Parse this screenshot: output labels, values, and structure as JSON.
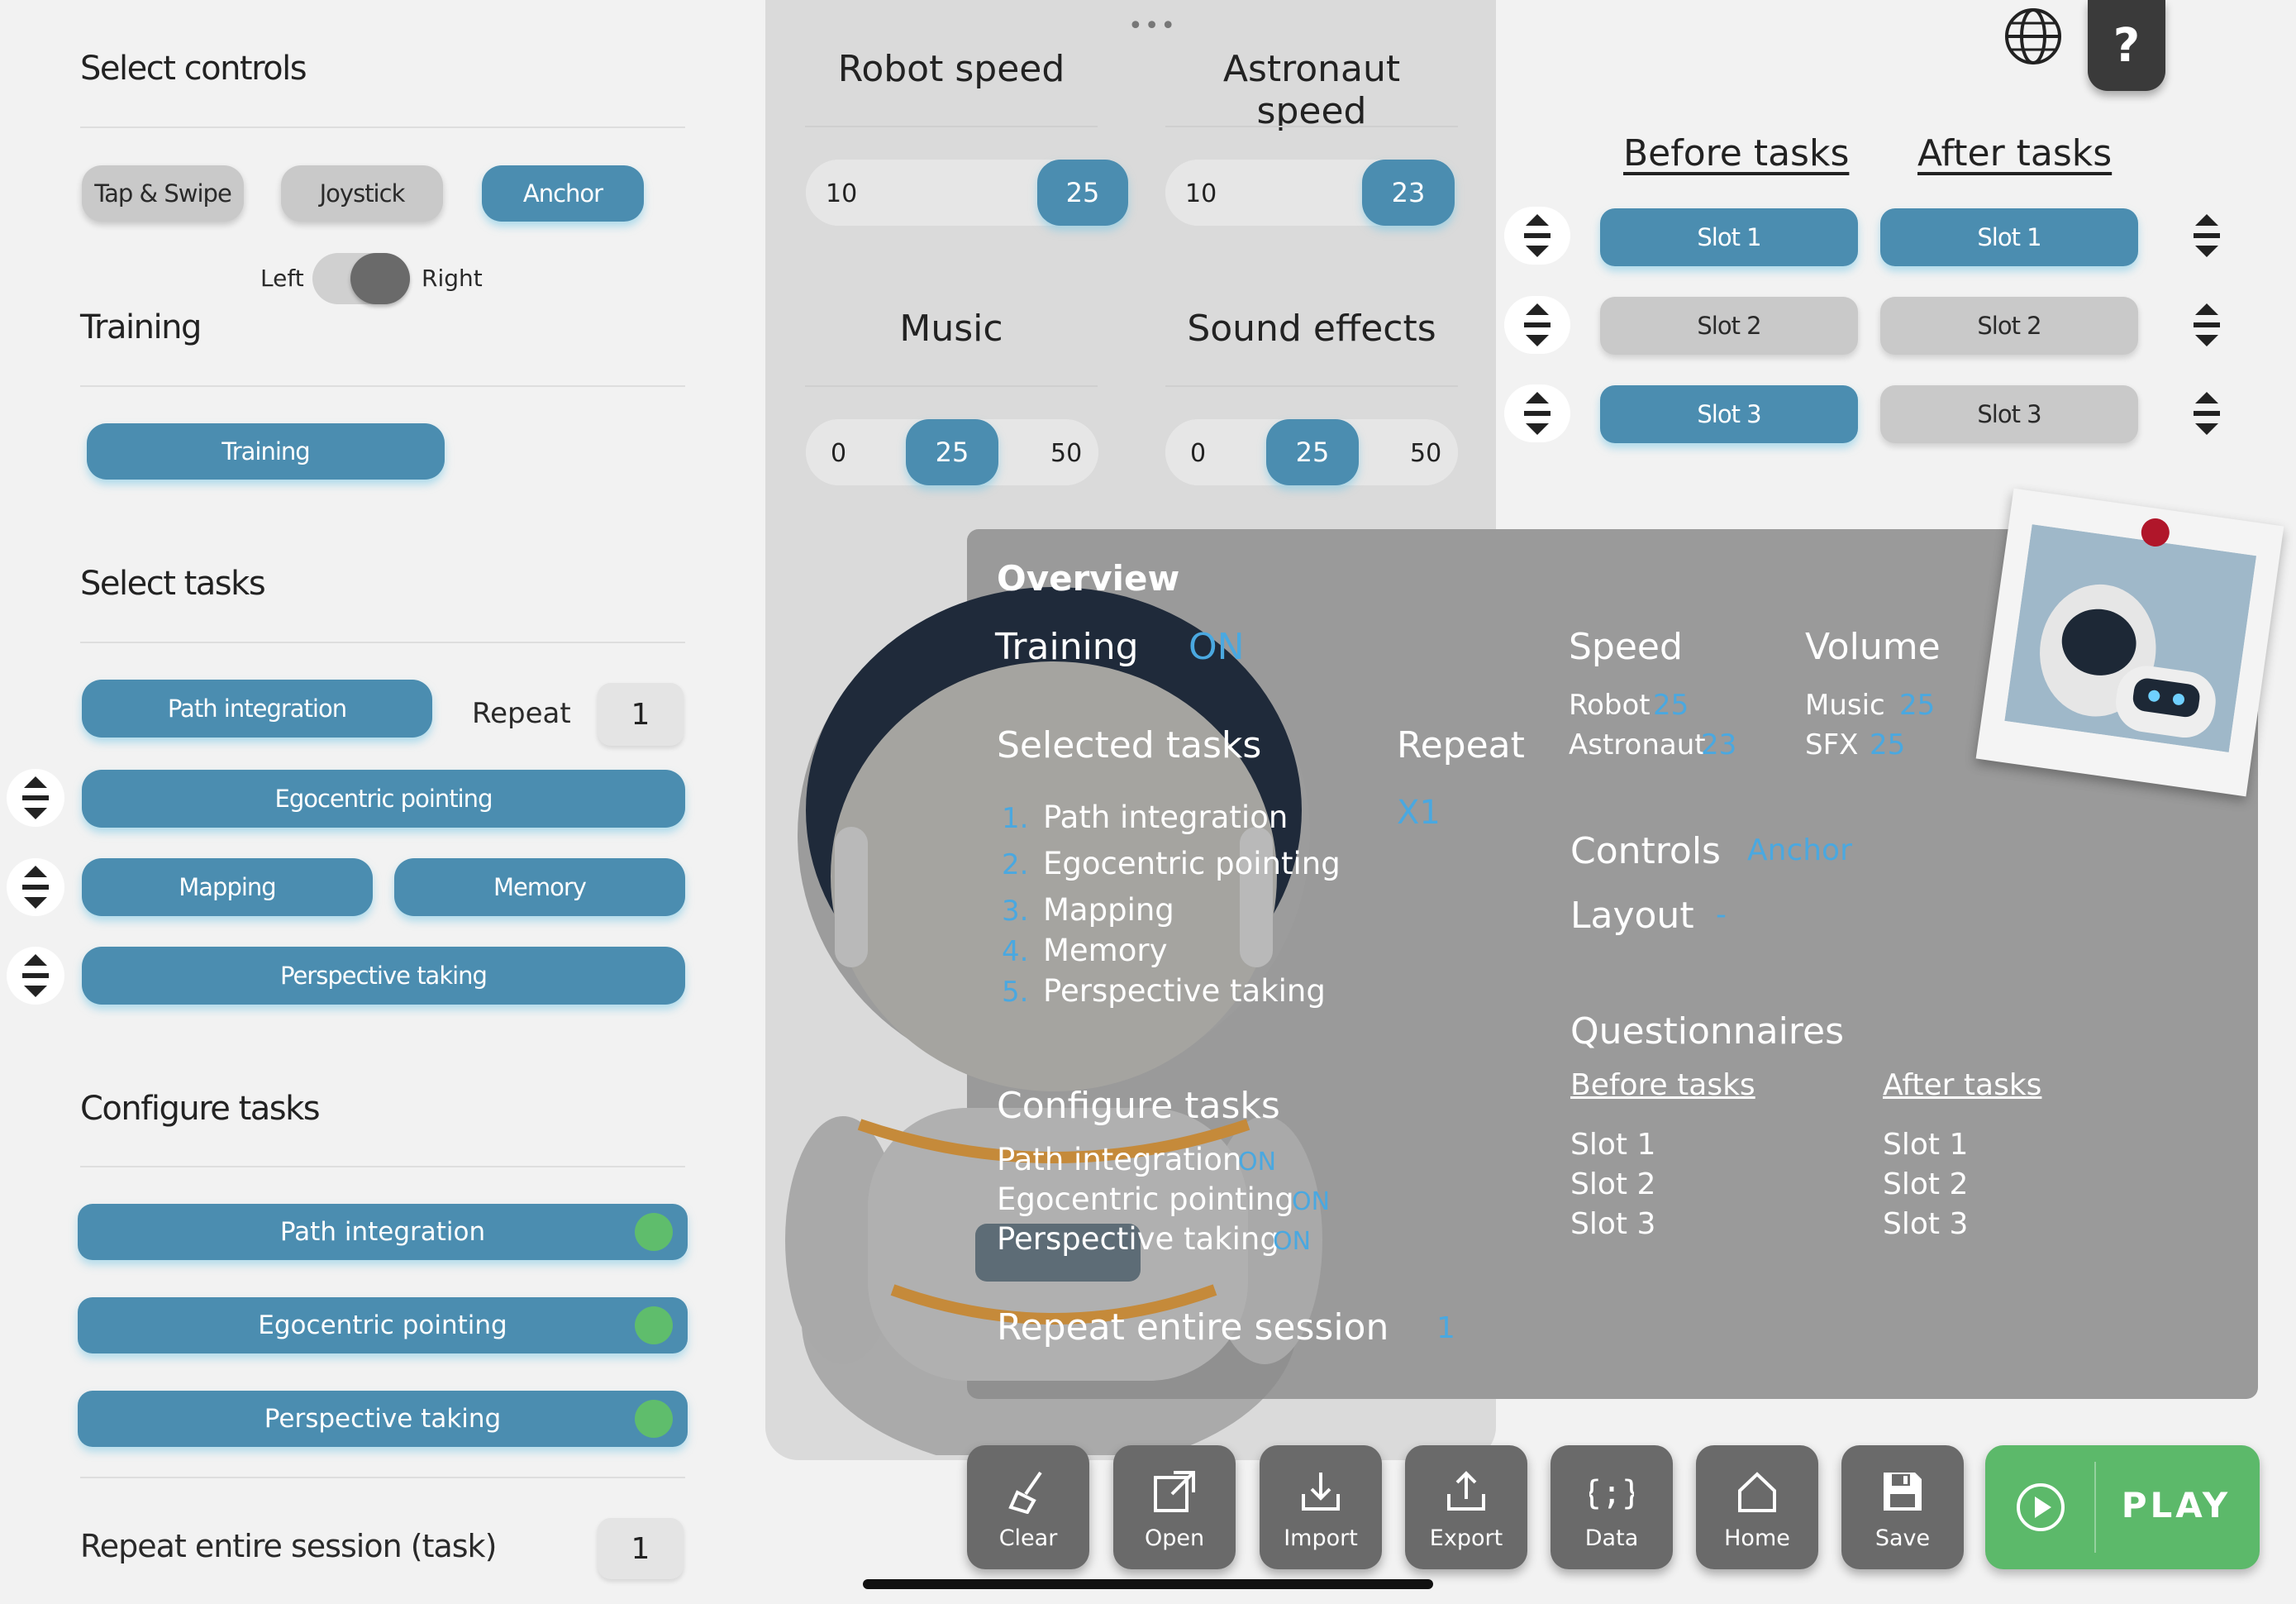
{
  "left": {
    "select_controls": "Select controls",
    "control_options": [
      "Tap & Swipe",
      "Joystick",
      "Anchor"
    ],
    "selected_control": "Anchor",
    "toggle_left": "Left",
    "toggle_right": "Right",
    "training_title": "Training",
    "training_button": "Training",
    "select_tasks": "Select tasks",
    "repeat_label": "Repeat",
    "repeat_value": "1",
    "tasks": {
      "path_integration": "Path integration",
      "egocentric_pointing": "Egocentric pointing",
      "mapping": "Mapping",
      "memory": "Memory",
      "perspective_taking": "Perspective taking"
    },
    "configure_tasks": "Configure tasks",
    "configure_items": [
      "Path integration",
      "Egocentric pointing",
      "Perspective taking"
    ],
    "repeat_session_label": "Repeat entire session (task)",
    "repeat_session_value": "1"
  },
  "middle": {
    "robot_speed": "Robot speed",
    "astronaut_speed": "Astronaut speed",
    "robot_min": "10",
    "robot_value": "25",
    "astronaut_min": "10",
    "astronaut_value": "23",
    "music": "Music",
    "sound_effects": "Sound effects",
    "music_min": "0",
    "music_value": "25",
    "music_max": "50",
    "sfx_min": "0",
    "sfx_value": "25",
    "sfx_max": "50"
  },
  "right": {
    "before_tasks": "Before tasks",
    "after_tasks": "After tasks",
    "before_slots": [
      "Slot 1",
      "Slot 2",
      "Slot 3"
    ],
    "after_slots": [
      "Slot 1",
      "Slot 2",
      "Slot 3"
    ],
    "help_label": "?"
  },
  "overview": {
    "title": "Overview",
    "training_label": "Training",
    "training_value": "ON",
    "selected_tasks": "Selected tasks",
    "repeat": "Repeat",
    "repeat_value": "X1",
    "task_numbers": [
      "1.",
      "2.",
      "3.",
      "4.",
      "5."
    ],
    "task_list": [
      "Path integration",
      "Egocentric pointing",
      "Mapping",
      "Memory",
      "Perspective taking"
    ],
    "configure_tasks": "Configure tasks",
    "configure_list": [
      "Path integration",
      "Egocentric pointing",
      "Perspective taking"
    ],
    "configure_state": "ON",
    "repeat_session": "Repeat entire session",
    "repeat_session_value": "1",
    "speed": "Speed",
    "robot_label": "Robot",
    "robot_value": "25",
    "astronaut_label": "Astronaut",
    "astronaut_value": "23",
    "volume": "Volume",
    "music_label": "Music",
    "music_value": "25",
    "sfx_label": "SFX",
    "sfx_value": "25",
    "controls_label": "Controls",
    "controls_value": "Anchor",
    "layout_label": "Layout",
    "layout_value": "-",
    "questionnaires": "Questionnaires",
    "before_tasks": "Before tasks",
    "after_tasks": "After tasks",
    "before_slots": [
      "Slot 1",
      "Slot 2",
      "Slot 3"
    ],
    "after_slots": [
      "Slot 1",
      "Slot 2",
      "Slot 3"
    ]
  },
  "toolbar": {
    "clear": "Clear",
    "open": "Open",
    "import": "Import",
    "export": "Export",
    "data": "Data",
    "home": "Home",
    "save": "Save",
    "play": "PLAY"
  },
  "colors": {
    "accent": "#4b8db0",
    "play": "#5cb96a",
    "overview_blue": "#4aa8e0"
  }
}
